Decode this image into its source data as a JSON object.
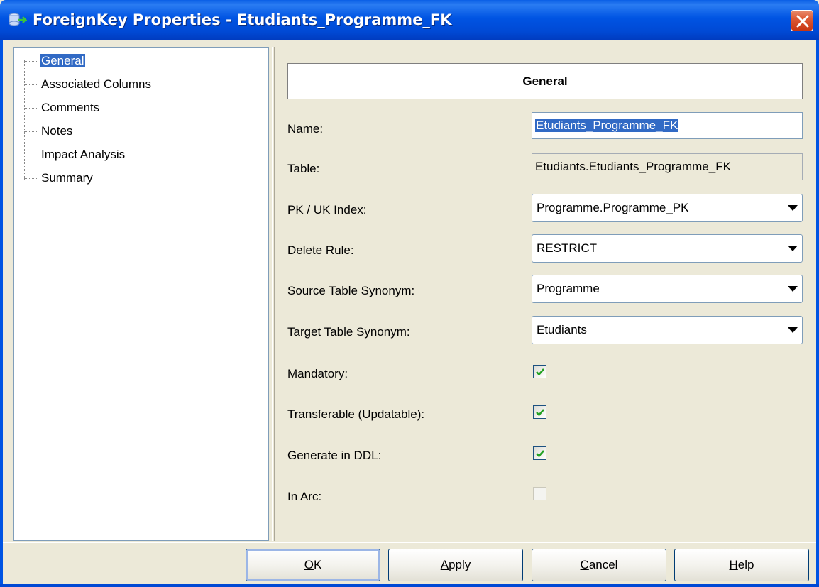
{
  "window": {
    "title": "ForeignKey Properties - Etudiants_Programme_FK",
    "accent": "#0054e3",
    "close_icon": "close-icon"
  },
  "tree": {
    "items": [
      {
        "label": "General",
        "selected": true
      },
      {
        "label": "Associated Columns",
        "selected": false
      },
      {
        "label": "Comments",
        "selected": false
      },
      {
        "label": "Notes",
        "selected": false
      },
      {
        "label": "Impact Analysis",
        "selected": false
      },
      {
        "label": "Summary",
        "selected": false
      }
    ]
  },
  "panel": {
    "header": "General",
    "fields": {
      "name": {
        "label": "Name:",
        "value": "Etudiants_Programme_FK"
      },
      "table": {
        "label": "Table:",
        "value": "Etudiants.Etudiants_Programme_FK"
      },
      "pk_uk_index": {
        "label": "PK / UK Index:",
        "value": "Programme.Programme_PK"
      },
      "delete_rule": {
        "label": "Delete Rule:",
        "value": "RESTRICT"
      },
      "source_table_synonym": {
        "label": "Source Table Synonym:",
        "value": "Programme"
      },
      "target_table_synonym": {
        "label": "Target Table Synonym:",
        "value": "Etudiants"
      },
      "mandatory": {
        "label": "Mandatory:",
        "checked": true
      },
      "transferable": {
        "label": "Transferable (Updatable):",
        "checked": true
      },
      "generate_in_ddl": {
        "label": "Generate in DDL:",
        "checked": true
      },
      "in_arc": {
        "label": "In Arc:",
        "checked": false,
        "enabled": false
      }
    }
  },
  "buttons": {
    "ok": {
      "mnemonic": "O",
      "rest": "K"
    },
    "apply": {
      "mnemonic": "A",
      "rest": "pply"
    },
    "cancel": {
      "mnemonic": "C",
      "rest": "ancel"
    },
    "help": {
      "mnemonic": "H",
      "rest": "elp"
    }
  }
}
